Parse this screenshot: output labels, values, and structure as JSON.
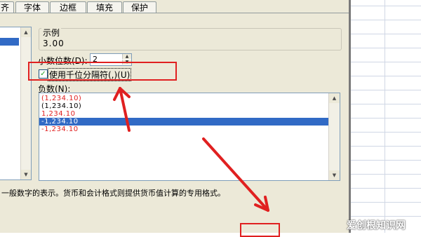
{
  "tabs": [
    {
      "label": "齐"
    },
    {
      "label": "字体"
    },
    {
      "label": "边框"
    },
    {
      "label": "填充"
    },
    {
      "label": "保护"
    }
  ],
  "sample": {
    "label": "示例",
    "value": "3.00"
  },
  "decimal": {
    "label": "小数位数(D):",
    "value": "2"
  },
  "thousands_separator": {
    "label": "使用千位分隔符(,)(U)",
    "checked": true
  },
  "negative": {
    "label": "负数(N):",
    "items": [
      {
        "text": "(1,234.10)",
        "color": "#e02020",
        "selected": false
      },
      {
        "text": "(1,234.10)",
        "color": "#000000",
        "selected": false
      },
      {
        "text": "1,234.10",
        "color": "#e02020",
        "selected": false
      },
      {
        "text": "-1,234.10",
        "color": "#ffffff",
        "selected": true
      },
      {
        "text": "-1,234.10",
        "color": "#e02020",
        "selected": false
      }
    ]
  },
  "description": "一般数字的表示。货币和会计格式则提供货币值计算的专用格式。",
  "watermark": "爱创根知识网",
  "colors": {
    "annotation": "#e02020",
    "selection": "#316ac5",
    "dialog_bg": "#ece9d8"
  },
  "icons": [
    "scroll-up-arrow-icon",
    "scroll-down-arrow-icon",
    "spin-up-icon",
    "spin-down-icon",
    "check-icon"
  ]
}
